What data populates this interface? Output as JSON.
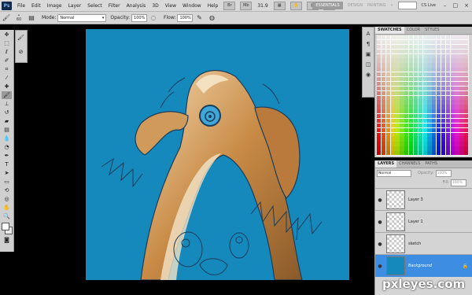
{
  "menubar": {
    "logo": "Ps",
    "items": [
      "File",
      "Edit",
      "Image",
      "Layer",
      "Select",
      "Filter",
      "Analysis",
      "3D",
      "View",
      "Window",
      "Help"
    ],
    "zoom": "31.9",
    "workspaces": {
      "essentials": "ESSENTIALS",
      "design": "DESIGN",
      "painting": "PAINTING"
    },
    "cs_live": "CS Live",
    "win_min": "–",
    "win_max": "□",
    "win_close": "×"
  },
  "options": {
    "brush_size": "60",
    "mode_label": "Mode:",
    "mode_value": "Normal",
    "opacity_label": "Opacity:",
    "opacity_value": "100%",
    "flow_label": "Flow:",
    "flow_value": "100%"
  },
  "swatches": {
    "tabs": [
      "SWATCHES",
      "COLOR",
      "STYLES"
    ]
  },
  "layers_panel": {
    "tabs": [
      "LAYERS",
      "CHANNELS",
      "PATHS"
    ],
    "blend_mode": "Normal",
    "opacity_label": "Opacity:",
    "opacity_value": "100%",
    "fill_label": "Fill:",
    "fill_value": "100%",
    "layers": [
      {
        "name": "Layer 3"
      },
      {
        "name": "Layer 1"
      },
      {
        "name": "sketch"
      },
      {
        "name": "Background"
      }
    ]
  },
  "watermark": "pxleyes.com",
  "colors": {
    "canvas_bg": "#1589bb",
    "selected_layer": "#3d8ee2"
  }
}
